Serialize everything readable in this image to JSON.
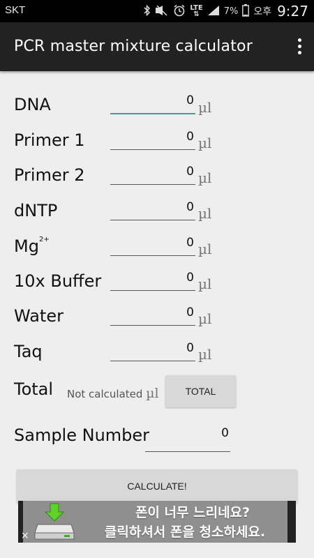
{
  "status_bar": {
    "carrier": "SKT",
    "network": "LTE",
    "battery_percent": "7%",
    "am_pm": "오후",
    "time": "9:27"
  },
  "app": {
    "title": "PCR master mixture calculator"
  },
  "ingredients": [
    {
      "label": "DNA",
      "value": "0",
      "unit": "µl"
    },
    {
      "label": "Primer 1",
      "value": "0",
      "unit": "µl"
    },
    {
      "label": "Primer 2",
      "value": "0",
      "unit": "µl"
    },
    {
      "label": "dNTP",
      "value": "0",
      "unit": "µl"
    },
    {
      "label": "Mg",
      "superscript": "2+",
      "value": "0",
      "unit": "µl"
    },
    {
      "label": "10x Buffer",
      "value": "0",
      "unit": "µl"
    },
    {
      "label": "Water",
      "value": "0",
      "unit": "µl"
    },
    {
      "label": "Taq",
      "value": "0",
      "unit": "µl"
    }
  ],
  "total": {
    "label": "Total",
    "value": "Not calculated",
    "unit": "µl",
    "button_label": "TOTAL"
  },
  "sample": {
    "label": "Sample Number",
    "value": "0"
  },
  "calculate_button": "CALCULATE!",
  "ad": {
    "line1": "폰이 너무 느리네요?",
    "line2": "클릭하셔서 폰을 청소하세요.",
    "close": "×"
  },
  "colors": {
    "background": "#eeeeee",
    "appbar": "#222222",
    "focus_underline": "#4a9a96",
    "button": "#d8d8d8"
  }
}
